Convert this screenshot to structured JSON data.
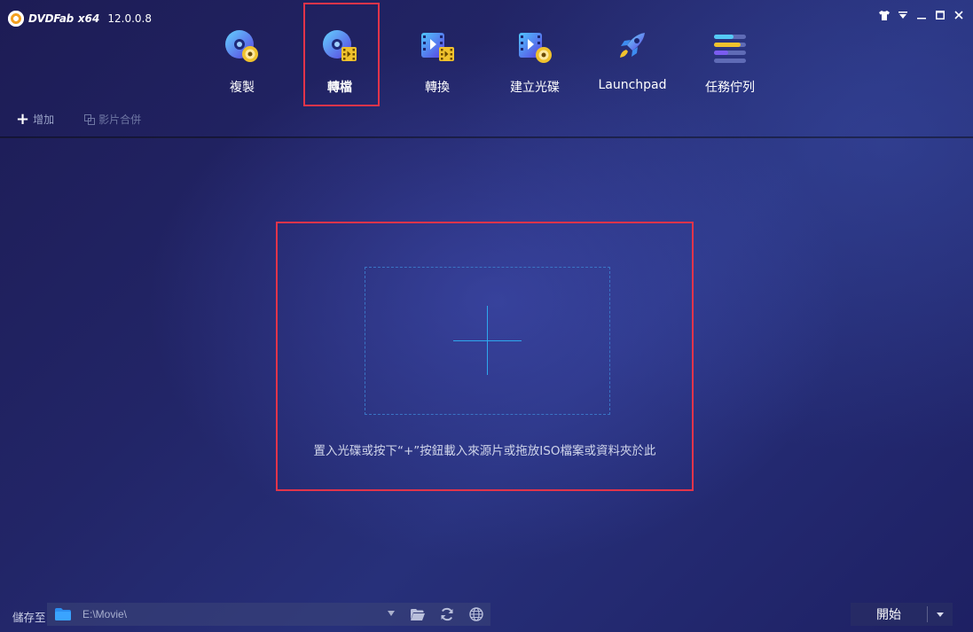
{
  "app": {
    "brand": "DVDFab",
    "arch": "x64",
    "version": "12.0.0.8"
  },
  "window_controls": [
    {
      "name": "skin-icon"
    },
    {
      "name": "menu-dropdown-icon"
    },
    {
      "name": "minimize-icon"
    },
    {
      "name": "maximize-icon"
    },
    {
      "name": "close-icon"
    }
  ],
  "nav": {
    "items": [
      {
        "label": "複製",
        "icon": "copy-disc-icon"
      },
      {
        "label": "轉檔",
        "icon": "ripper-disc-film-icon",
        "active": true
      },
      {
        "label": "轉換",
        "icon": "converter-film-icon"
      },
      {
        "label": "建立光碟",
        "icon": "creator-film-disc-icon"
      },
      {
        "label": "Launchpad",
        "icon": "rocket-icon"
      },
      {
        "label": "任務佇列",
        "icon": "task-queue-icon"
      }
    ]
  },
  "toolbar": {
    "add_label": "增加",
    "merge_label": "影片合併"
  },
  "dropzone": {
    "hint": "置入光碟或按下“+”按鈕載入來源片或拖放ISO檔案或資料夾於此"
  },
  "bottom": {
    "save_to_label": "儲存至",
    "path_value": "E:\\Movie\\",
    "start_label": "開始"
  },
  "colors": {
    "highlight": "#e2344a",
    "accent_blue": "#2ea8ef"
  }
}
